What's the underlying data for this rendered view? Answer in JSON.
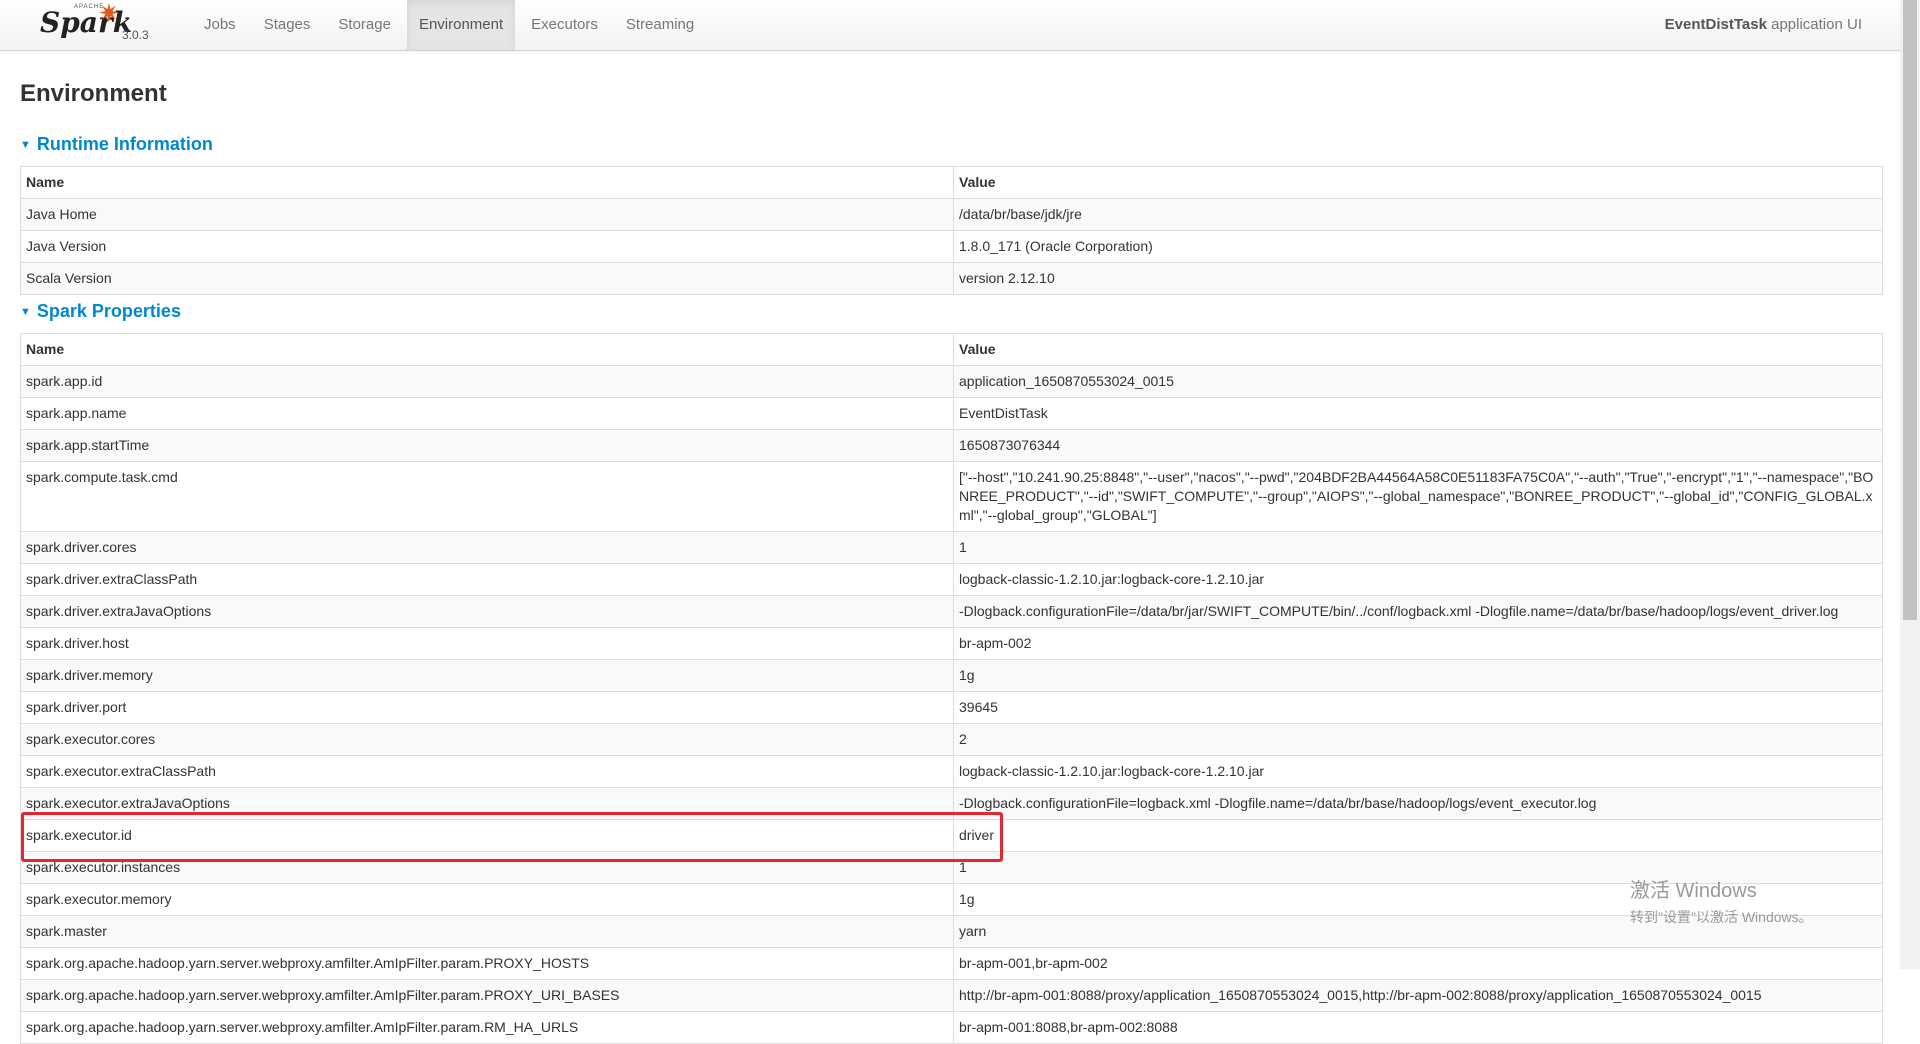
{
  "brand": {
    "apache": "APACHE",
    "spark": "Spark",
    "version": "3.0.3"
  },
  "nav": [
    "Jobs",
    "Stages",
    "Storage",
    "Environment",
    "Executors",
    "Streaming"
  ],
  "app": {
    "name": "EventDistTask",
    "suffix": " application UI"
  },
  "page_title": "Environment",
  "runtime": {
    "title": "Runtime Information",
    "headers": [
      "Name",
      "Value"
    ],
    "rows": [
      [
        "Java Home",
        "/data/br/base/jdk/jre"
      ],
      [
        "Java Version",
        "1.8.0_171 (Oracle Corporation)"
      ],
      [
        "Scala Version",
        "version 2.12.10"
      ]
    ]
  },
  "spark_props": {
    "title": "Spark Properties",
    "headers": [
      "Name",
      "Value"
    ],
    "rows": [
      [
        "spark.app.id",
        "application_1650870553024_0015"
      ],
      [
        "spark.app.name",
        "EventDistTask"
      ],
      [
        "spark.app.startTime",
        "1650873076344"
      ],
      [
        "spark.compute.task.cmd",
        "[\"--host\",\"10.241.90.25:8848\",\"--user\",\"nacos\",\"--pwd\",\"204BDF2BA44564A58C0E51183FA75C0A\",\"--auth\",\"True\",\"-encrypt\",\"1\",\"--namespace\",\"BONREE_PRODUCT\",\"--id\",\"SWIFT_COMPUTE\",\"--group\",\"AIOPS\",\"--global_namespace\",\"BONREE_PRODUCT\",\"--global_id\",\"CONFIG_GLOBAL.xml\",\"--global_group\",\"GLOBAL\"]"
      ],
      [
        "spark.driver.cores",
        "1"
      ],
      [
        "spark.driver.extraClassPath",
        "logback-classic-1.2.10.jar:logback-core-1.2.10.jar"
      ],
      [
        "spark.driver.extraJavaOptions",
        "-Dlogback.configurationFile=/data/br/jar/SWIFT_COMPUTE/bin/../conf/logback.xml -Dlogfile.name=/data/br/base/hadoop/logs/event_driver.log"
      ],
      [
        "spark.driver.host",
        "br-apm-002"
      ],
      [
        "spark.driver.memory",
        "1g"
      ],
      [
        "spark.driver.port",
        "39645"
      ],
      [
        "spark.executor.cores",
        "2"
      ],
      [
        "spark.executor.extraClassPath",
        "logback-classic-1.2.10.jar:logback-core-1.2.10.jar"
      ],
      [
        "spark.executor.extraJavaOptions",
        "-Dlogback.configurationFile=logback.xml -Dlogfile.name=/data/br/base/hadoop/logs/event_executor.log"
      ],
      [
        "spark.executor.id",
        "driver"
      ],
      [
        "spark.executor.instances",
        "1"
      ],
      [
        "spark.executor.memory",
        "1g"
      ],
      [
        "spark.master",
        "yarn"
      ],
      [
        "spark.org.apache.hadoop.yarn.server.webproxy.amfilter.AmIpFilter.param.PROXY_HOSTS",
        "br-apm-001,br-apm-002"
      ],
      [
        "spark.org.apache.hadoop.yarn.server.webproxy.amfilter.AmIpFilter.param.PROXY_URI_BASES",
        "http://br-apm-001:8088/proxy/application_1650870553024_0015,http://br-apm-002:8088/proxy/application_1650870553024_0015"
      ],
      [
        "spark.org.apache.hadoop.yarn.server.webproxy.amfilter.AmIpFilter.param.RM_HA_URLS",
        "br-apm-001:8088,br-apm-002:8088"
      ]
    ]
  },
  "watermark": {
    "line1": "激活 Windows",
    "line2": "转到\"设置\"以激活 Windows。"
  },
  "colors": {
    "link": "#0088cc",
    "highlight": "#e8242f",
    "spark_star": "#e25a1c"
  }
}
